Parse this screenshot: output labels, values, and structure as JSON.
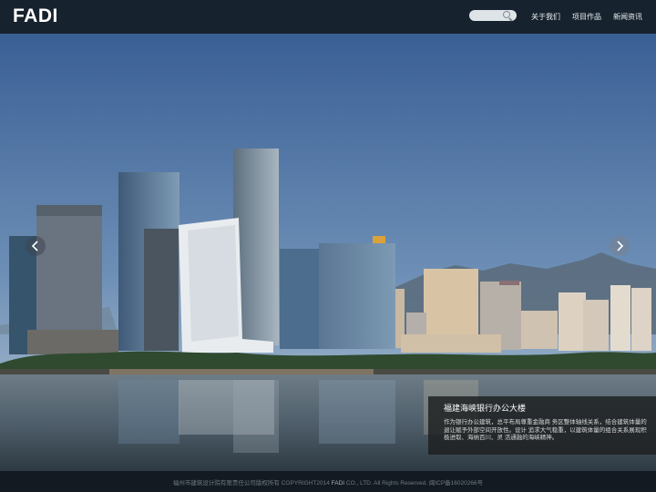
{
  "header": {
    "logo": "FADI",
    "search": {
      "placeholder": ""
    },
    "nav": [
      "关于我们",
      "项目作品",
      "新闻资讯"
    ]
  },
  "hero": {
    "caption_title": "福建海峡银行办公大楼",
    "caption_desc": "作为银行办公建筑，总平布局尊重金融商 务区整体轴线关系，结合建筑体量的退让赋予外部空间开放性。设计 追求大气稳重，以建筑体量的组合关系展现积极进取、海纳百川、灵 活通融的海峡精神。"
  },
  "footer": {
    "copyright_pre": "福州市建筑设计院有限责任公司版权所有 COPYRIGHT2014",
    "copyright_brand": "FADI",
    "copyright_post": "CO., LTD. All Rights Reserved.",
    "icp": "闽ICP备16020266号"
  },
  "colors": {
    "header_bg": "#16222d",
    "footer_bg": "#131a21",
    "sky_top": "#3a5f95",
    "sky_bottom": "#b9c8d4"
  }
}
